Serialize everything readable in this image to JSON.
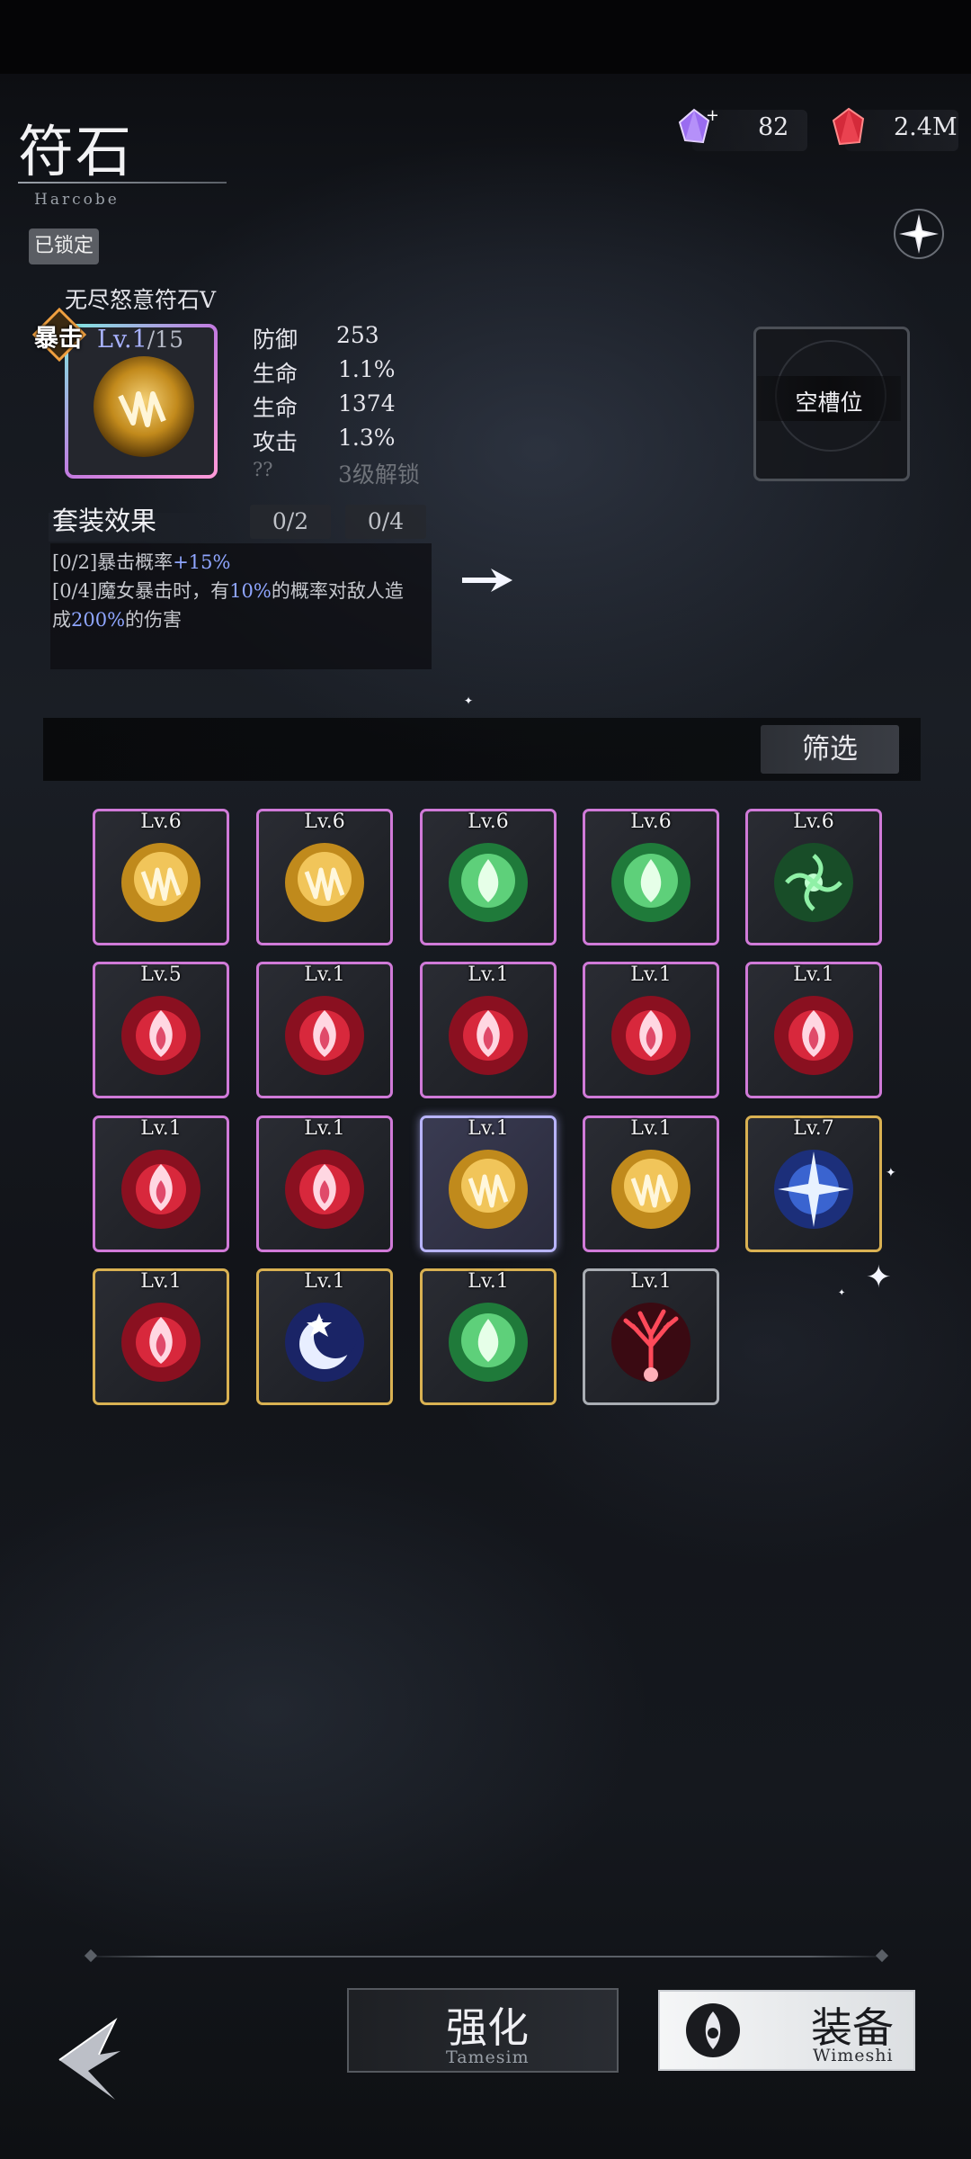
{
  "header": {
    "title": "符石",
    "subtitle": "Harcobe",
    "lock_label": "已锁定"
  },
  "currency": {
    "crystal": "82",
    "ruby": "2.4M"
  },
  "selected_rune": {
    "name": "无尽怒意符石Ⅴ",
    "badge": "暴击",
    "level": "Lv.1",
    "max_level": "/15",
    "stats": [
      {
        "label": "防御",
        "value": "253"
      },
      {
        "label": "生命",
        "value": "1.1%"
      },
      {
        "label": "生命",
        "value": "1374"
      },
      {
        "label": "攻击",
        "value": "1.3%"
      },
      {
        "label": "??",
        "value": "3级解锁"
      }
    ]
  },
  "empty_slot_label": "空槽位",
  "set_effect": {
    "title": "套装效果",
    "count_2": "0/2",
    "count_4": "0/4",
    "line1_prefix": "[0/2]暴击概率",
    "line1_hl": "+15%",
    "line2_prefix": "[0/4]魔女暴击时，有",
    "line2_hl1": "10%",
    "line2_mid": "的概率对敌人造",
    "line3_prefix": "成",
    "line3_hl": "200%",
    "line3_suffix": "的伤害"
  },
  "filter_label": "筛选",
  "inventory": [
    {
      "level": "Lv.6",
      "rune": "gold-claw",
      "frame": "rainbow"
    },
    {
      "level": "Lv.6",
      "rune": "gold-claw",
      "frame": "rainbow"
    },
    {
      "level": "Lv.6",
      "rune": "green-drop",
      "frame": "rainbow"
    },
    {
      "level": "Lv.6",
      "rune": "green-drop",
      "frame": "rainbow"
    },
    {
      "level": "Lv.6",
      "rune": "green-swirl",
      "frame": "rainbow"
    },
    {
      "level": "Lv.5",
      "rune": "red-flame",
      "frame": "rainbow"
    },
    {
      "level": "Lv.1",
      "rune": "red-flame",
      "frame": "rainbow"
    },
    {
      "level": "Lv.1",
      "rune": "red-flame",
      "frame": "rainbow"
    },
    {
      "level": "Lv.1",
      "rune": "red-flame",
      "frame": "rainbow"
    },
    {
      "level": "Lv.1",
      "rune": "red-flame",
      "frame": "rainbow"
    },
    {
      "level": "Lv.1",
      "rune": "red-flame",
      "frame": "rainbow"
    },
    {
      "level": "Lv.1",
      "rune": "red-flame",
      "frame": "rainbow"
    },
    {
      "level": "Lv.1",
      "rune": "gold-claw",
      "frame": "selected"
    },
    {
      "level": "Lv.1",
      "rune": "gold-claw",
      "frame": "rainbow"
    },
    {
      "level": "Lv.7",
      "rune": "blue-cross",
      "frame": "gold"
    },
    {
      "level": "Lv.1",
      "rune": "red-flame",
      "frame": "gold"
    },
    {
      "level": "Lv.1",
      "rune": "blue-moon",
      "frame": "gold"
    },
    {
      "level": "Lv.1",
      "rune": "green-drop",
      "frame": "gold"
    },
    {
      "level": "Lv.1",
      "rune": "red-tree",
      "frame": "silver"
    }
  ],
  "bottom": {
    "enhance_label": "强化",
    "enhance_sub": "Tamesim",
    "equip_label": "装备",
    "equip_sub": "Wimeshi"
  },
  "colors": {
    "accent_blue": "#8fa6ff",
    "frame_rainbow": "#d07ad8",
    "frame_gold": "#d9b152",
    "frame_silver": "#a9adb3",
    "frame_selected": "#b8b4ff"
  }
}
